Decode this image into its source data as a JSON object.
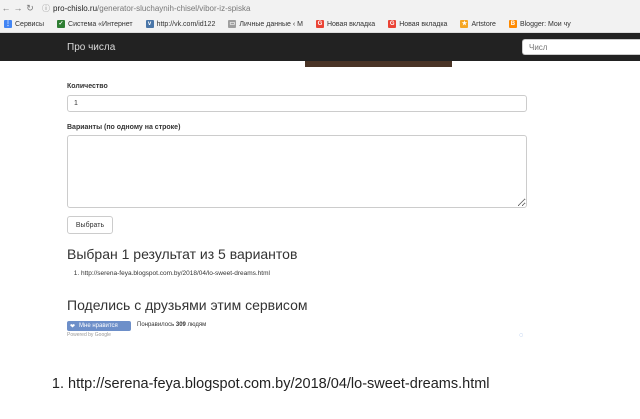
{
  "browser": {
    "url_host": "pro-chislo.ru",
    "url_path": "/generator-sluchaynih-chisel/vibor-iz-spiska",
    "bookmarks": [
      {
        "label": "Сервисы",
        "icon": "apps-icon",
        "color": "#4285f4"
      },
      {
        "label": "Система «Интернет",
        "icon": "bookmark-icon",
        "color": "#2e7d32"
      },
      {
        "label": "http://vk.com/id122",
        "icon": "vk-icon",
        "color": "#4a76a8"
      },
      {
        "label": "Личные данные ‹ М",
        "icon": "doc-icon",
        "color": "#9e9e9e"
      },
      {
        "label": "Новая вкладка",
        "icon": "google-icon",
        "color": "#ea4335"
      },
      {
        "label": "Новая вкладка",
        "icon": "google-icon",
        "color": "#ea4335"
      },
      {
        "label": "Artstore",
        "icon": "star-icon",
        "color": "#f5a623"
      },
      {
        "label": "Blogger: Мои чу",
        "icon": "blogger-icon",
        "color": "#ff8a00"
      }
    ]
  },
  "header": {
    "brand": "Про числа",
    "search_placeholder": "Числ"
  },
  "form": {
    "quantity_label": "Количество",
    "quantity_value": "1",
    "variants_label": "Варианты (по одному на строке)",
    "submit_label": "Выбрать"
  },
  "result": {
    "heading": "Выбран 1 результат из 5 вариантов",
    "items": [
      "http://serena-feya.blogspot.com.by/2018/04/lo-sweet-dreams.html"
    ]
  },
  "share": {
    "heading": "Поделись с друзьями этим сервисом",
    "like_button": "Мне нравится",
    "like_prefix": "Понравилось ",
    "like_count": "309",
    "like_suffix": " людям",
    "powered": "Powered by Google"
  },
  "caption": {
    "items": [
      "http://serena-feya.blogspot.com.by/2018/04/lo-sweet-dreams.html"
    ]
  }
}
